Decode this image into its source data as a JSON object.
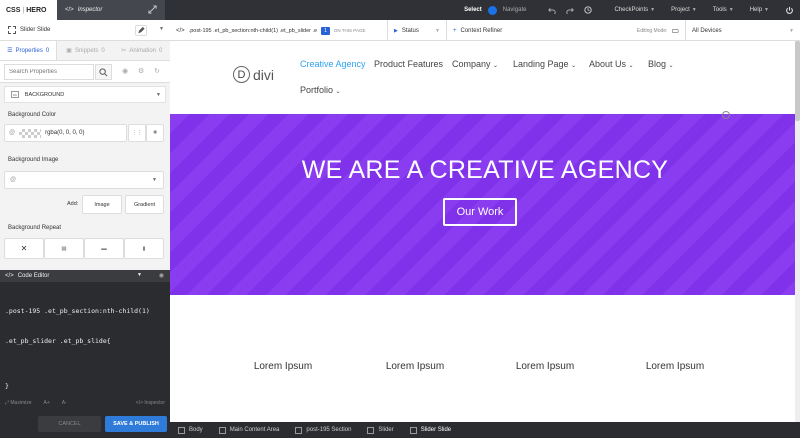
{
  "topbar": {
    "logo_a": "CSS",
    "logo_sep": "|",
    "logo_b": "HERO",
    "inspector_label": "Inspector",
    "select_label": "Select",
    "navigate_label": "Navigate",
    "checkpoints_label": "CheckPoints",
    "project_label": "Project",
    "tools_label": "Tools",
    "help_label": "Help",
    "accent": "#1a73e8"
  },
  "left": {
    "selector_label": "Slider Slide",
    "tabs": [
      {
        "label": "Properties",
        "count": "0"
      },
      {
        "label": "Snippets",
        "count": "0"
      },
      {
        "label": "Animation",
        "count": "0"
      }
    ],
    "search_placeholder": "Search Properties",
    "group_label": "BACKGROUND",
    "bg_color_label": "Background Color",
    "bg_color_value": "rgba(0, 0, 0, 0)",
    "bg_image_label": "Background Image",
    "add_label": "Add:",
    "image_btn": "Image",
    "gradient_btn": "Gradient",
    "bg_repeat_label": "Background Repeat"
  },
  "code_editor": {
    "title": "Code Editor",
    "line1": ".post-195 .et_pb_section:nth-child(1)",
    "line2": ".et_pb_slider .et_pb_slide{",
    "close": "}",
    "tool_maximize": "Maximize",
    "tool_a_plus": "A+",
    "tool_a_minus": "A-",
    "tool_inspector": "Inspector",
    "cancel": "CANCEL",
    "save": "SAVE & PUBLISH"
  },
  "editor_toolbar": {
    "selector_path": ".post-195 .et_pb_section:nth-child(1) .et_pb_slider .e",
    "badge": "1",
    "on_page": "ON THIS PAGE",
    "status": "Status",
    "context": "Context Refiner",
    "editing_mode": "Editing Mode:",
    "device": "All Devices"
  },
  "site": {
    "logo_letter": "D",
    "logo_word": "divi",
    "nav": [
      "Creative Agency",
      "Product Features",
      "Company",
      "Landing Page",
      "About Us",
      "Blog",
      "Portfolio"
    ],
    "hero_title": "WE ARE A CREATIVE AGENCY",
    "hero_button": "Our Work",
    "hero_color": "#8a3cf0",
    "lorem": [
      "Lorem Ipsum",
      "Lorem Ipsum",
      "Lorem Ipsum",
      "Lorem Ipsum"
    ]
  },
  "breadcrumb": {
    "items": [
      "Body",
      "Main Content Area",
      "post-195 Section",
      "Slider",
      "Slider Slide"
    ]
  }
}
